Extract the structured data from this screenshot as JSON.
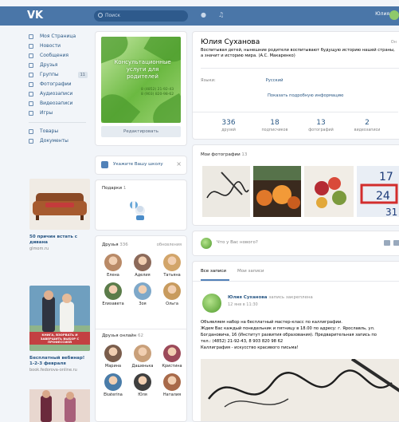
{
  "header": {
    "logo": "VK",
    "search_placeholder": "Поиск",
    "user_name": "Юлия"
  },
  "nav": {
    "items": [
      {
        "label": "Моя Страница",
        "icon": "home-icon"
      },
      {
        "label": "Новости",
        "icon": "news-icon"
      },
      {
        "label": "Сообщения",
        "icon": "messages-icon"
      },
      {
        "label": "Друзья",
        "icon": "friends-icon"
      },
      {
        "label": "Группы",
        "icon": "groups-icon",
        "badge": "11"
      },
      {
        "label": "Фотографии",
        "icon": "photo-icon"
      },
      {
        "label": "Аудиозаписи",
        "icon": "music-icon"
      },
      {
        "label": "Видеозаписи",
        "icon": "video-icon"
      },
      {
        "label": "Игры",
        "icon": "games-icon"
      }
    ],
    "items2": [
      {
        "label": "Товары",
        "icon": "goods-icon"
      },
      {
        "label": "Документы",
        "icon": "documents-icon"
      }
    ]
  },
  "ads": [
    {
      "title": "50 причин встать с дивана",
      "sub": "glmom.ru"
    },
    {
      "title": "Бесплатный вебинар! 1-2-3 февраля",
      "sub": "book.fedorova-online.ru",
      "image_caption": "КНИГА, ВЗОРВАТЬ И ЗАВЕРШИТЬ ВЫБОР С ПРОФЕССИЕЙ"
    }
  ],
  "profile_photo": {
    "title": "Консультационные услуги для родителей",
    "phone": "8 (4852) 21-92-43\n8 (903) 820-98-62"
  },
  "edit_button": "Редактировать",
  "school_card": {
    "label": "Укажите Вашу школу",
    "close": "×"
  },
  "gifts": {
    "title": "Подарки",
    "count": "1"
  },
  "friends": {
    "title": "Друзья",
    "count": "336",
    "updates": "обновления",
    "list": [
      {
        "name": "Елена",
        "color": "#b98a67"
      },
      {
        "name": "Аделия",
        "color": "#8c6a5a"
      },
      {
        "name": "Татьяна",
        "color": "#d2a56a"
      },
      {
        "name": "Елизавета",
        "color": "#5b7c4a"
      },
      {
        "name": "Зоя",
        "color": "#7ea8c9"
      },
      {
        "name": "Ольга",
        "color": "#c89b5e"
      }
    ]
  },
  "friends_online": {
    "title": "Друзья онлайн",
    "count": "62",
    "list": [
      {
        "name": "Марина",
        "color": "#7a5d4c"
      },
      {
        "name": "Дашенька",
        "color": "#c9a07a"
      },
      {
        "name": "Кристина",
        "color": "#9c4a5a"
      },
      {
        "name": "Ekaterina",
        "color": "#4a7ca8"
      },
      {
        "name": "Юля",
        "color": "#3f3f3f"
      },
      {
        "name": "Наталия",
        "color": "#a86a4a"
      }
    ]
  },
  "profile": {
    "name": "Юлия Суханова",
    "online": "Он",
    "status": "Воспитывая детей, нынешние родители воспитывают будущую историю нашей страны, а значит и историю мира. (А.С. Макаренко)",
    "language_label": "Языки:",
    "language_value": "Русский",
    "show_more": "Показать подробную информацию",
    "counters": [
      {
        "n": "336",
        "l": "друзей"
      },
      {
        "n": "18",
        "l": "подписчиков"
      },
      {
        "n": "13",
        "l": "фотографий"
      },
      {
        "n": "2",
        "l": "видеозаписи"
      }
    ]
  },
  "photos": {
    "title": "Мои фотографии",
    "count": "13"
  },
  "new_post": {
    "placeholder": "Что у Вас нового?"
  },
  "wall": {
    "tabs": [
      "Все записи",
      "Мои записи"
    ],
    "author": "Юлия Суханова",
    "pinned": "запись закреплена",
    "time": "12 янв в 11:30",
    "text": [
      "Объявляем набор на бесплатный мастер-класс по каллиграфии.",
      "Ждем Вас каждый понедельник и пятницу в 18.00 по адресу: г. Ярославль, ул.",
      "Богдановича, 16 (Институт развития образования). Предварительная запись по",
      "тел.: (4852) 21-92-43, 8 903 820 98 62",
      "Каллиграфия - искусство красивого письма!"
    ]
  },
  "colors": {
    "header": "#4a76a8",
    "link": "#2a5885",
    "page_bg": "#f2f5f9"
  }
}
